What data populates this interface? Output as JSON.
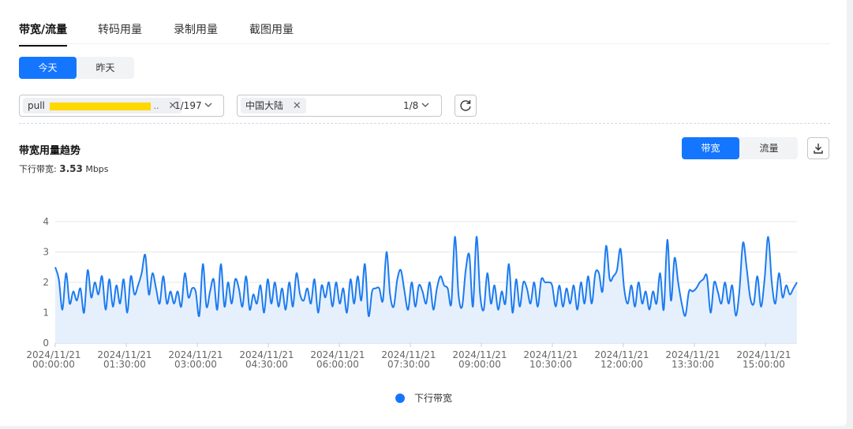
{
  "tabs": [
    {
      "label": "带宽/流量",
      "active": true
    },
    {
      "label": "转码用量",
      "active": false
    },
    {
      "label": "录制用量",
      "active": false
    },
    {
      "label": "截图用量",
      "active": false
    }
  ],
  "day_toggle": {
    "today": "今天",
    "yesterday": "昨天",
    "selected": "今天"
  },
  "stream_select": {
    "chip": "pull",
    "count": "1/197"
  },
  "region_select": {
    "chip": "中国大陆",
    "count": "1/8"
  },
  "chart_section": {
    "title": "带宽用量趋势",
    "metric_label": "下行带宽:",
    "metric_value": "3.53",
    "metric_unit": "Mbps",
    "toggle_bandwidth": "带宽",
    "toggle_traffic": "流量",
    "selected": "带宽"
  },
  "colors": {
    "accent": "#1476ff",
    "line": "#1c7bf0",
    "area": "#e6f0fd"
  },
  "chart_data": {
    "type": "area",
    "title": "",
    "xlabel": "",
    "ylabel": "",
    "ylim": [
      0,
      4
    ],
    "yticks": [
      0,
      1,
      2,
      3,
      4
    ],
    "grid": true,
    "legend_position": "bottom",
    "x_tick_labels": [
      [
        "2024/11/21",
        "00:00:00"
      ],
      [
        "2024/11/21",
        "01:30:00"
      ],
      [
        "2024/11/21",
        "03:00:00"
      ],
      [
        "2024/11/21",
        "04:30:00"
      ],
      [
        "2024/11/21",
        "06:00:00"
      ],
      [
        "2024/11/21",
        "07:30:00"
      ],
      [
        "2024/11/21",
        "09:00:00"
      ],
      [
        "2024/11/21",
        "10:30:00"
      ],
      [
        "2024/11/21",
        "12:00:00"
      ],
      [
        "2024/11/21",
        "13:30:00"
      ],
      [
        "2024/11/21",
        "15:00:00"
      ]
    ],
    "x_range_hours": [
      0,
      15.67
    ],
    "series": [
      {
        "name": "下行带宽",
        "values": [
          2.5,
          2.1,
          1.1,
          2.3,
          1.3,
          1.7,
          1.4,
          1.8,
          1.0,
          2.4,
          1.5,
          2.0,
          1.6,
          2.2,
          1.1,
          2.1,
          1.2,
          1.9,
          1.3,
          2.1,
          1.0,
          2.2,
          1.6,
          1.9,
          2.3,
          2.9,
          1.6,
          2.3,
          1.8,
          1.3,
          2.2,
          1.3,
          1.7,
          1.3,
          1.7,
          1.2,
          2.3,
          1.5,
          1.8,
          1.7,
          0.9,
          2.6,
          1.2,
          1.7,
          2.1,
          1.1,
          2.6,
          1.2,
          2.0,
          1.3,
          2.1,
          1.8,
          1.2,
          2.2,
          1.1,
          1.6,
          1.3,
          1.9,
          1.0,
          2.1,
          1.3,
          2.0,
          1.2,
          1.8,
          1.1,
          2.0,
          1.2,
          2.3,
          1.6,
          1.4,
          1.8,
          1.3,
          2.1,
          1.0,
          1.9,
          1.5,
          2.0,
          1.2,
          2.0,
          1.3,
          1.8,
          1.0,
          2.1,
          1.3,
          2.2,
          1.4,
          2.6,
          0.9,
          1.7,
          1.8,
          1.8,
          1.4,
          3.0,
          1.6,
          1.2,
          2.1,
          2.4,
          1.7,
          1.1,
          2.0,
          1.2,
          1.9,
          1.7,
          1.3,
          2.0,
          1.1,
          1.8,
          2.2,
          1.9,
          1.8,
          1.3,
          3.5,
          1.6,
          1.2,
          2.4,
          2.9,
          1.2,
          3.5,
          1.6,
          1.1,
          2.3,
          1.3,
          1.9,
          1.1,
          1.7,
          1.3,
          2.6,
          1.0,
          2.1,
          1.2,
          2.0,
          1.8,
          1.3,
          2.0,
          1.2,
          2.1,
          2.0,
          2.0,
          1.9,
          1.2,
          1.9,
          1.2,
          1.8,
          1.3,
          1.9,
          1.1,
          2.0,
          1.3,
          2.2,
          1.3,
          2.3,
          2.3,
          1.7,
          3.2,
          2.1,
          2.2,
          2.4,
          3.1,
          1.8,
          1.3,
          1.9,
          1.2,
          2.0,
          1.3,
          1.7,
          1.1,
          1.7,
          1.3,
          2.3,
          1.1,
          3.4,
          1.4,
          2.8,
          2.0,
          1.3,
          0.9,
          1.7,
          1.7,
          1.8,
          2.0,
          2.1,
          2.2,
          1.0,
          2.0,
          1.7,
          1.3,
          2.0,
          1.3,
          1.9,
          0.9,
          1.7,
          3.3,
          2.5,
          1.5,
          1.3,
          2.2,
          1.2,
          2.1,
          3.5,
          2.0,
          1.3,
          2.3,
          1.5,
          1.9,
          1.6,
          1.8,
          2.0
        ]
      }
    ]
  }
}
